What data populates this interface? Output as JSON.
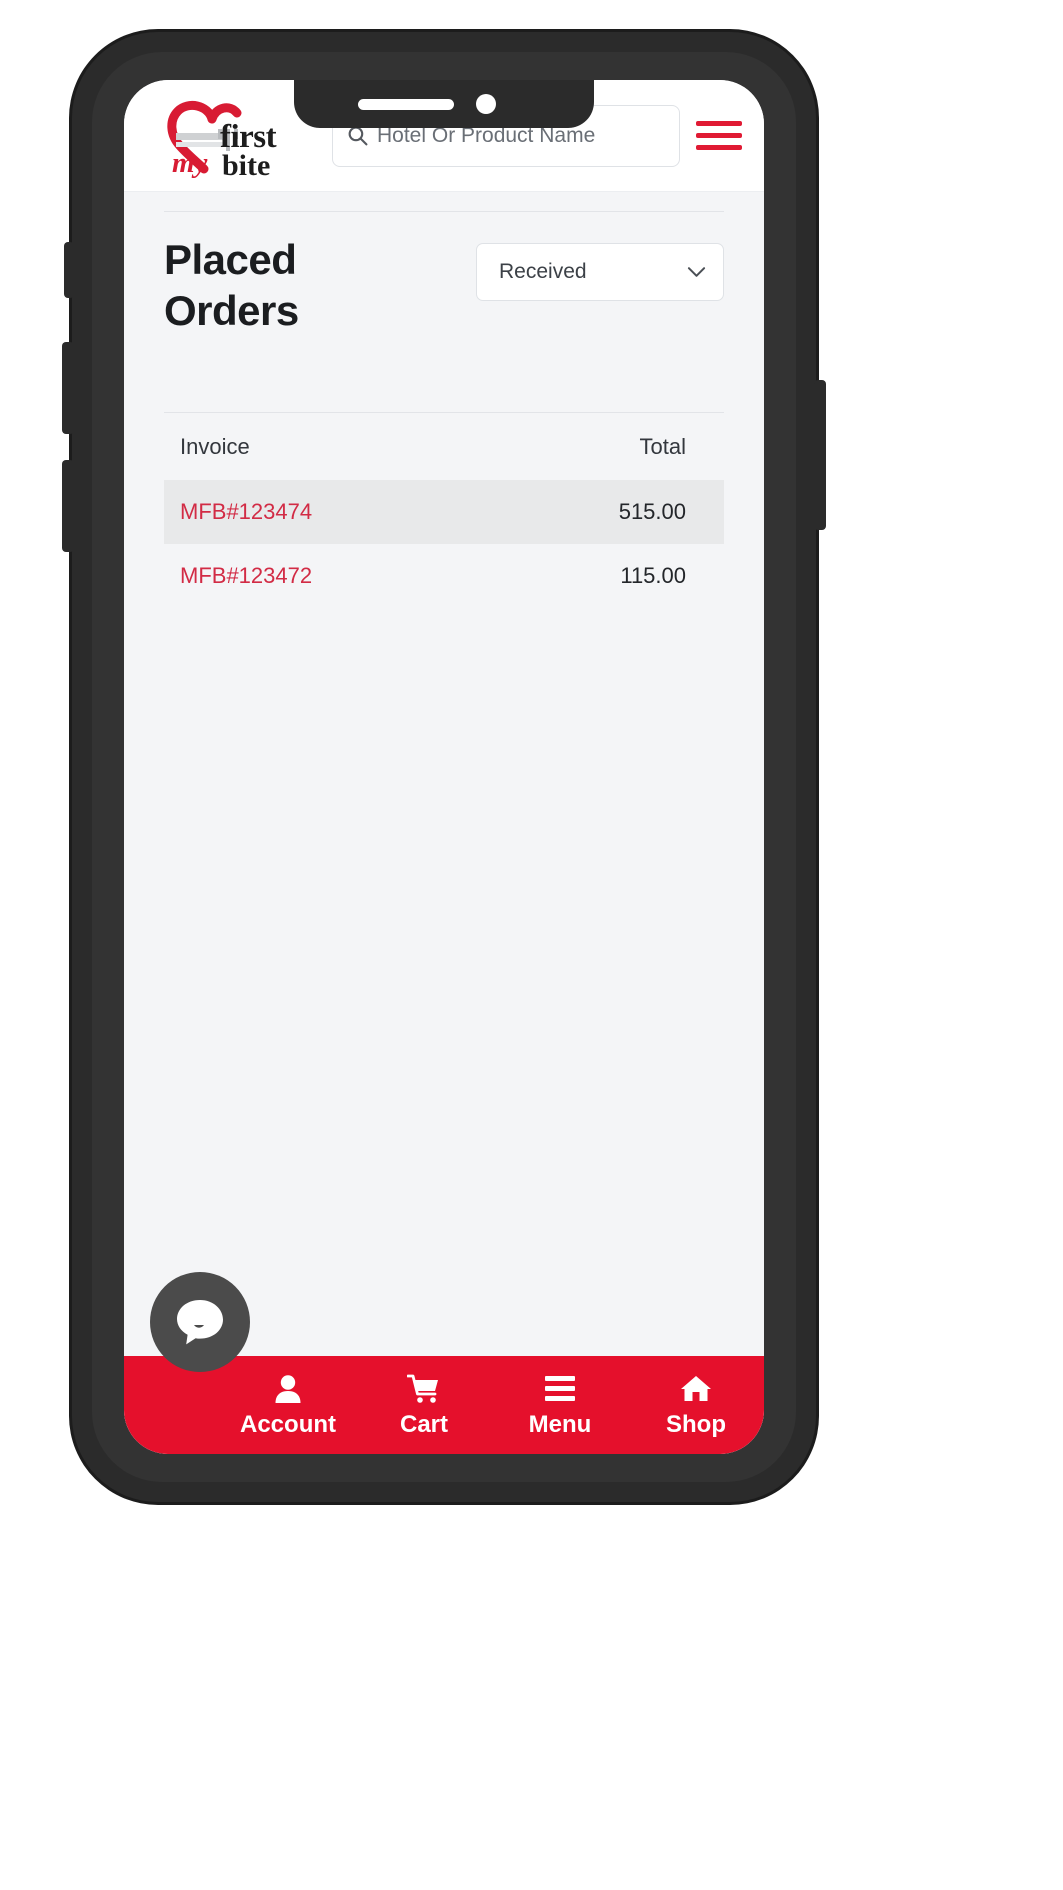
{
  "header": {
    "logo": {
      "word_my": "my",
      "word_first": "first",
      "word_bite": "bite",
      "heart_color": "#d81b33",
      "fork_color": "#c9cbcd"
    },
    "search": {
      "placeholder": "Hotel Or Product Name",
      "value": "",
      "icon": "search-icon"
    },
    "menu_icon": "hamburger-menu-icon",
    "menu_icon_color": "#e01a33"
  },
  "main": {
    "page_title": "Placed Orders",
    "status_filter": {
      "selected": "Received",
      "chevron_icon": "chevron-down-icon"
    },
    "table": {
      "columns": [
        "Invoice",
        "Total"
      ],
      "rows": [
        {
          "invoice": "MFB#123474",
          "total": "515.00",
          "highlighted": true
        },
        {
          "invoice": "MFB#123472",
          "total": "115.00",
          "highlighted": false
        }
      ]
    }
  },
  "chat_widget": {
    "icon": "chat-bubble-icon",
    "background_color": "#4b4b4b"
  },
  "bottom_nav": {
    "background_color": "#e5102c",
    "items": [
      {
        "label": "Account",
        "icon": "user-icon"
      },
      {
        "label": "Cart",
        "icon": "shopping-cart-icon"
      },
      {
        "label": "Menu",
        "icon": "hamburger-menu-icon"
      },
      {
        "label": "Shop",
        "icon": "home-icon"
      }
    ]
  }
}
